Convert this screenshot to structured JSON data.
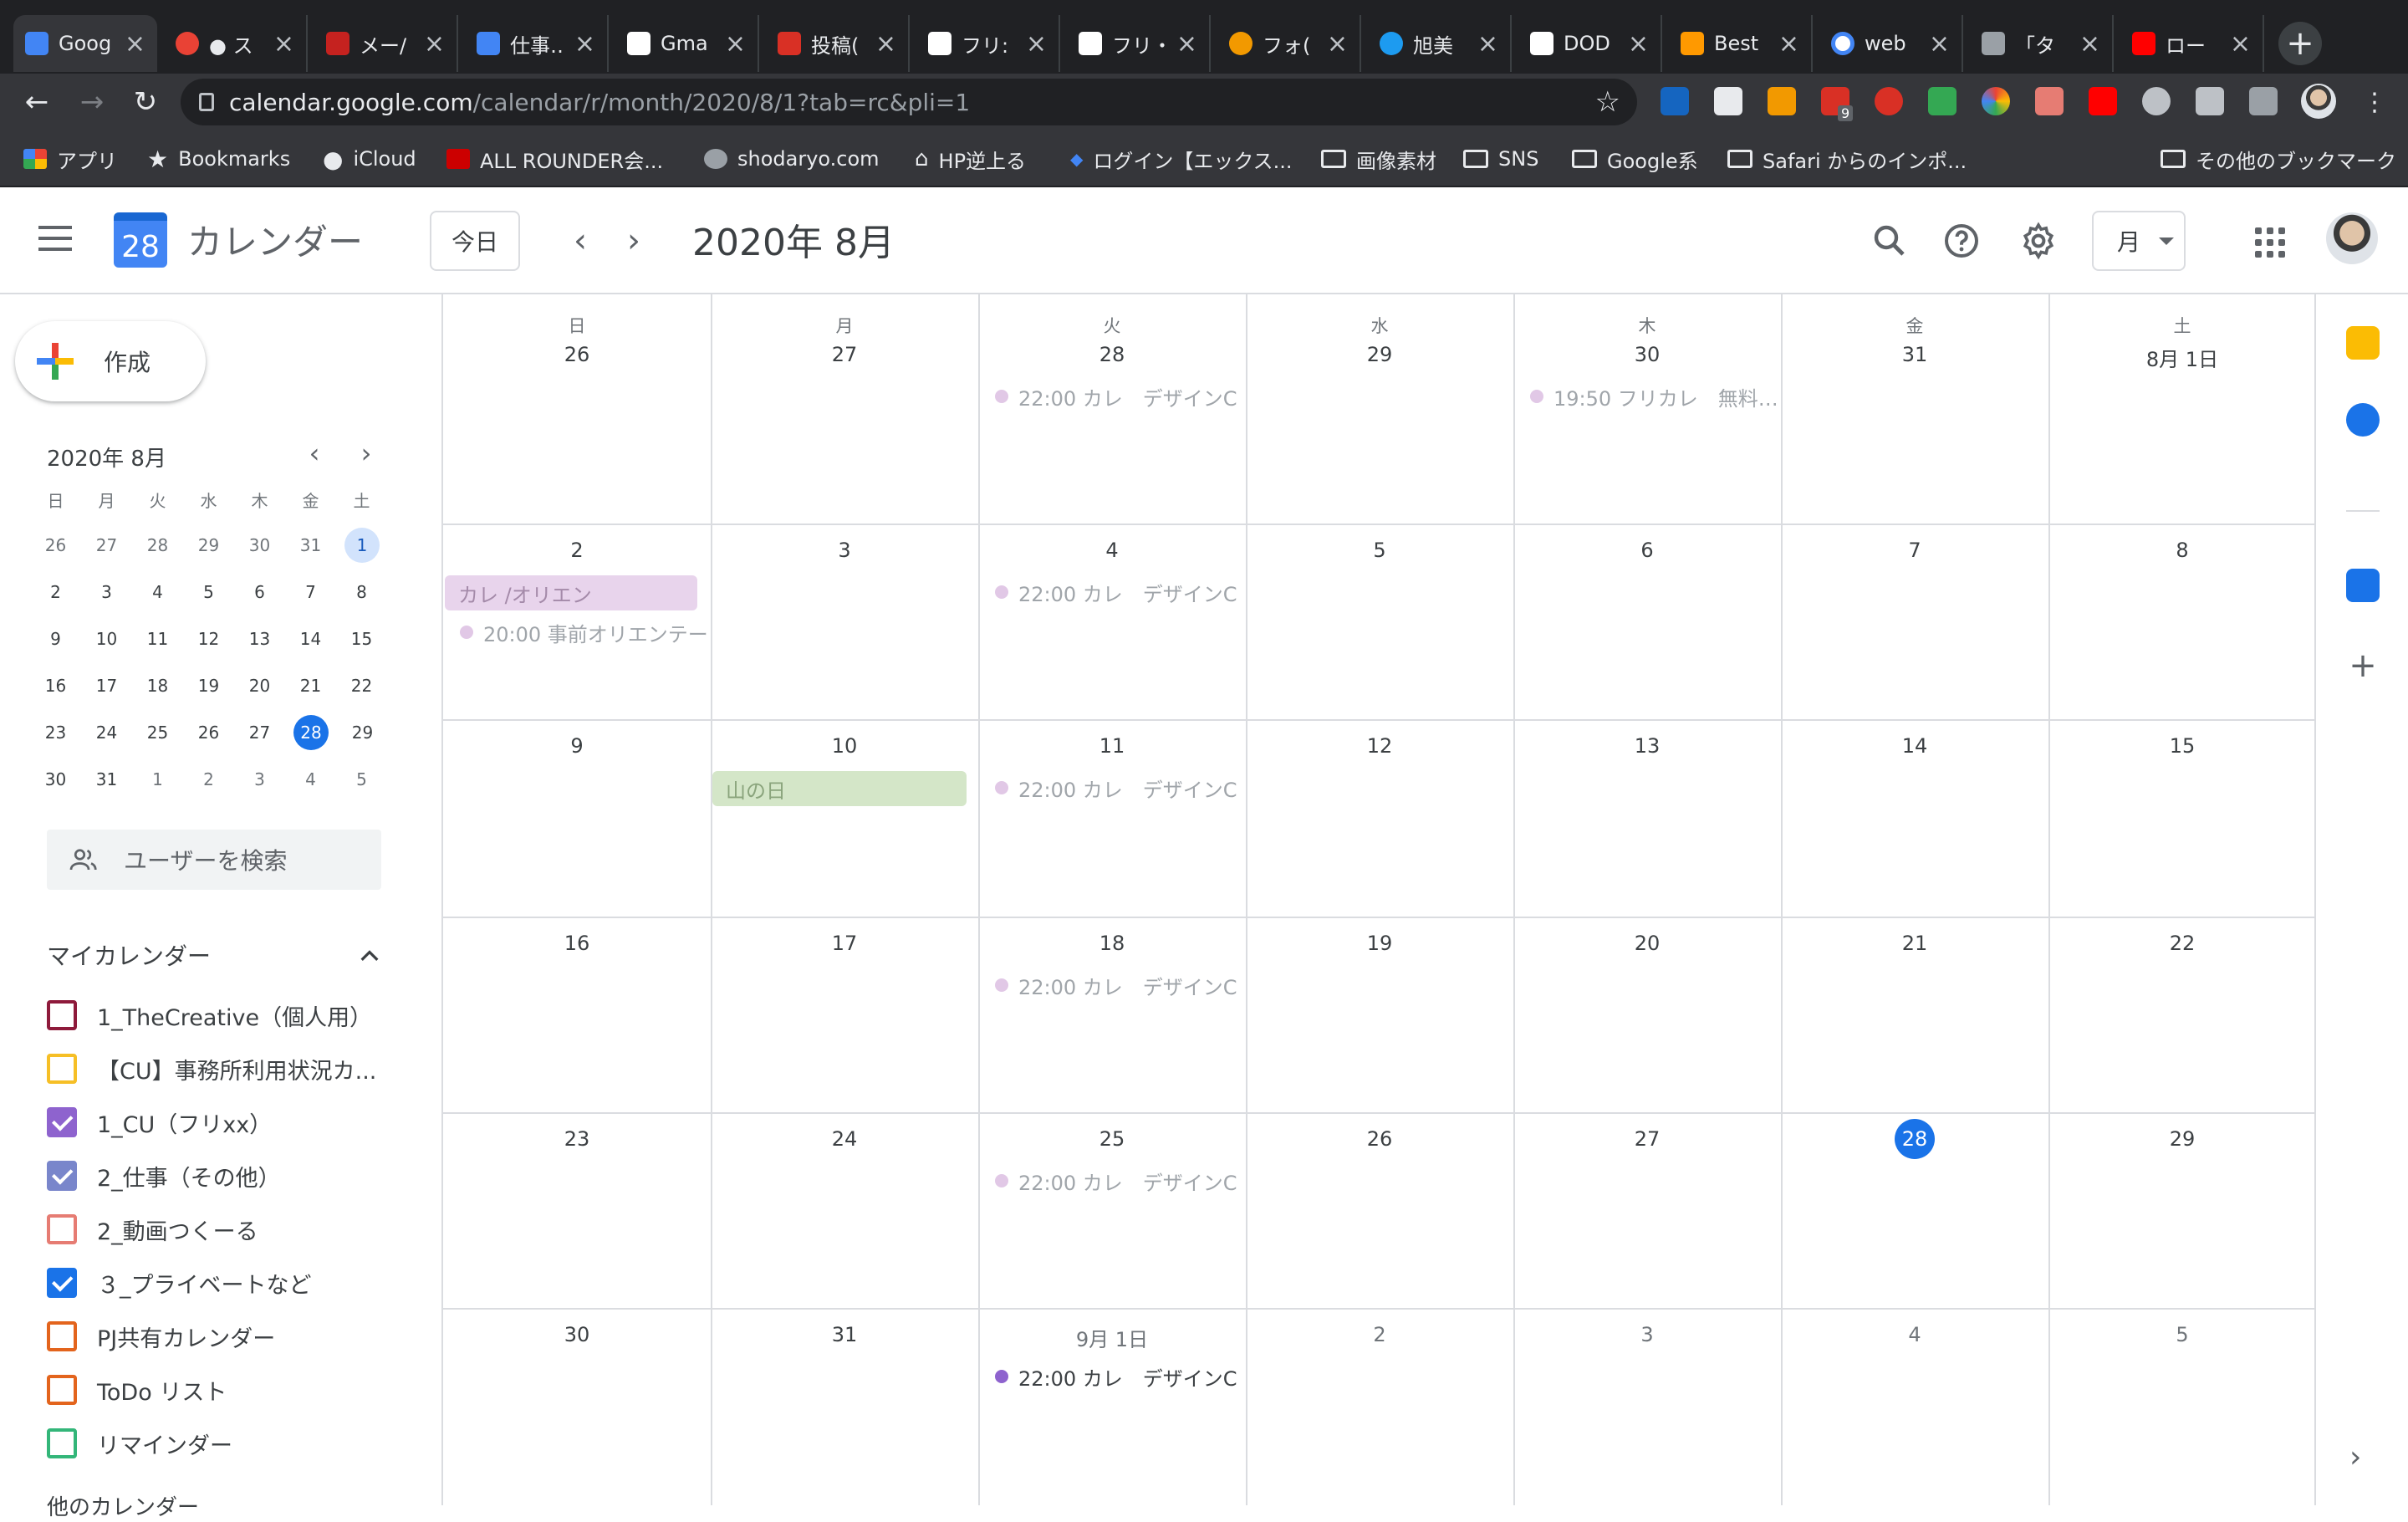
{
  "browser": {
    "tabs": [
      {
        "title": "Goog",
        "active": true,
        "color": "#4285f4"
      },
      {
        "title": "● ス",
        "color": "#e94235"
      },
      {
        "title": "メー/",
        "color": "#c5221f"
      },
      {
        "title": "仕事…",
        "color": "#4285f4"
      },
      {
        "title": "Gma",
        "color": "#ffffff"
      },
      {
        "title": "投稿(",
        "color": "#d93025"
      },
      {
        "title": "フリ:",
        "color": "#ffffff"
      },
      {
        "title": "フリ・",
        "color": "#ffffff"
      },
      {
        "title": "フォ(",
        "color": "#f29900"
      },
      {
        "title": "旭美",
        "color": "#1d9bf0"
      },
      {
        "title": "DOD",
        "color": "#ffffff"
      },
      {
        "title": "Best",
        "color": "#ff9900"
      },
      {
        "title": "web",
        "color": "#4285f4"
      },
      {
        "title": "「タ",
        "color": "#9aa0a6"
      },
      {
        "title": "ロー",
        "color": "#ff0000"
      }
    ],
    "url_host": "calendar.google.com",
    "url_path": "/calendar/r/month/2020/8/1?tab=rc&pli=1",
    "extension_badge": "9",
    "bookmarks": [
      {
        "label": "アプリ",
        "icon": "apps-grid-icon"
      },
      {
        "label": "Bookmarks",
        "icon": "star-icon"
      },
      {
        "label": "iCloud",
        "icon": "apple-icon"
      },
      {
        "label": "ALL ROUNDER会...",
        "icon": "site-icon"
      },
      {
        "label": "shodaryo.com",
        "icon": "globe-icon"
      },
      {
        "label": "HP逆上る",
        "icon": "museum-icon"
      },
      {
        "label": "ログイン【エックス...",
        "icon": "site-icon"
      },
      {
        "label": "画像素材",
        "icon": "folder-icon"
      },
      {
        "label": "SNS",
        "icon": "folder-icon"
      },
      {
        "label": "Google系",
        "icon": "folder-icon"
      },
      {
        "label": "Safari からのインポ...",
        "icon": "folder-icon"
      }
    ],
    "other_bookmarks": "その他のブックマーク"
  },
  "app": {
    "logo_day": "28",
    "name": "カレンダー",
    "today_button": "今日",
    "month_title": "2020年 8月",
    "view_selector": "月"
  },
  "sidebar": {
    "create_label": "作成",
    "mini_cal": {
      "title": "2020年 8月",
      "dow": [
        "日",
        "月",
        "火",
        "水",
        "木",
        "金",
        "土"
      ],
      "weeks": [
        [
          "26",
          "27",
          "28",
          "29",
          "30",
          "31",
          "1"
        ],
        [
          "2",
          "3",
          "4",
          "5",
          "6",
          "7",
          "8"
        ],
        [
          "9",
          "10",
          "11",
          "12",
          "13",
          "14",
          "15"
        ],
        [
          "16",
          "17",
          "18",
          "19",
          "20",
          "21",
          "22"
        ],
        [
          "23",
          "24",
          "25",
          "26",
          "27",
          "28",
          "29"
        ],
        [
          "30",
          "31",
          "1",
          "2",
          "3",
          "4",
          "5"
        ]
      ]
    },
    "search_people_placeholder": "ユーザーを検索",
    "my_calendars_title": "マイカレンダー",
    "calendars": [
      {
        "name": "1_TheCreative（個人用）",
        "color": "#8e1a3b",
        "checked": false
      },
      {
        "name": "【CU】事務所利用状況カ...",
        "color": "#f6bf26",
        "checked": false
      },
      {
        "name": "1_CU（フリxx）",
        "color": "#8e63ce",
        "checked": true
      },
      {
        "name": "2_仕事（その他）",
        "color": "#7986cb",
        "checked": true
      },
      {
        "name": "2_動画つくーる",
        "color": "#e67c73",
        "checked": false
      },
      {
        "name": "３_プライベートなど",
        "color": "#1a73e8",
        "checked": true
      },
      {
        "name": "PJ共有カレンダー",
        "color": "#e3641d",
        "checked": false
      },
      {
        "name": "ToDo リスト",
        "color": "#e3641d",
        "checked": false
      },
      {
        "name": "リマインダー",
        "color": "#33b679",
        "checked": false
      }
    ],
    "other_calendars_title": "他のカレンダー"
  },
  "month": {
    "dow": [
      "日",
      "月",
      "火",
      "水",
      "木",
      "金",
      "土"
    ],
    "weeks": [
      [
        "26",
        "27",
        "28",
        "29",
        "30",
        "31",
        "8月 1日"
      ],
      [
        "2",
        "3",
        "4",
        "5",
        "6",
        "7",
        "8"
      ],
      [
        "9",
        "10",
        "11",
        "12",
        "13",
        "14",
        "15"
      ],
      [
        "16",
        "17",
        "18",
        "19",
        "20",
        "21",
        "22"
      ],
      [
        "23",
        "24",
        "25",
        "26",
        "27",
        "28",
        "29"
      ],
      [
        "30",
        "31",
        "9月 1日",
        "2",
        "3",
        "4",
        "5"
      ]
    ],
    "events": {
      "w0_tue": "22:00 カレ　デザインC",
      "w0_thu": "19:50 フリカレ　無料…",
      "w1_sun_allday": "カレ /オリエン",
      "w1_sun": "20:00 事前オリエンテー",
      "w1_tue": "22:00 カレ　デザインC",
      "w2_mon_holiday": "山の日",
      "w2_tue": "22:00 カレ　デザインC",
      "w3_tue": "22:00 カレ　デザインC",
      "w4_tue": "22:00 カレ　デザインC",
      "w5_tue": "22:00 カレ　デザインC"
    }
  },
  "colors": {
    "accent": "#1a73e8",
    "past_event_dot": "#e1c8e6",
    "future_event_dot": "#8e63ce",
    "allday_event_bg": "#e8d4ec",
    "holiday_bg": "#d4e6c8"
  }
}
